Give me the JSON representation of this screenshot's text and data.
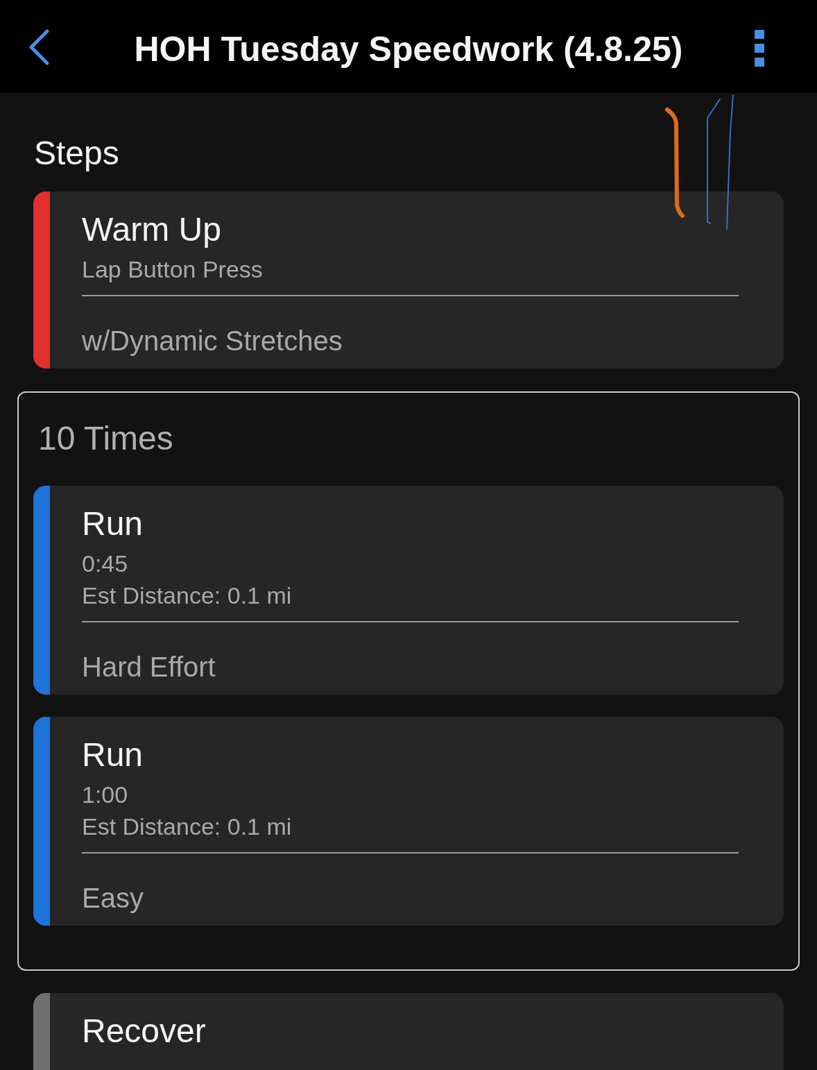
{
  "header": {
    "title": "HOH Tuesday Speedwork (4.8.25)"
  },
  "section_title": "Steps",
  "steps": [
    {
      "kind": "step",
      "title": "Warm Up",
      "color": "#e03030",
      "details": [
        "Lap Button Press"
      ],
      "note": "w/Dynamic Stretches"
    },
    {
      "kind": "repeat",
      "label": "10 Times",
      "steps": [
        {
          "kind": "step",
          "title": "Run",
          "color": "#1e74d8",
          "details": [
            "0:45",
            "Est Distance: 0.1 mi"
          ],
          "note": "Hard Effort"
        },
        {
          "kind": "step",
          "title": "Run",
          "color": "#1e74d8",
          "details": [
            "1:00",
            "Est Distance: 0.1 mi"
          ],
          "note": "Easy"
        }
      ]
    },
    {
      "kind": "step",
      "title": "Recover",
      "color": "#707070"
    }
  ]
}
